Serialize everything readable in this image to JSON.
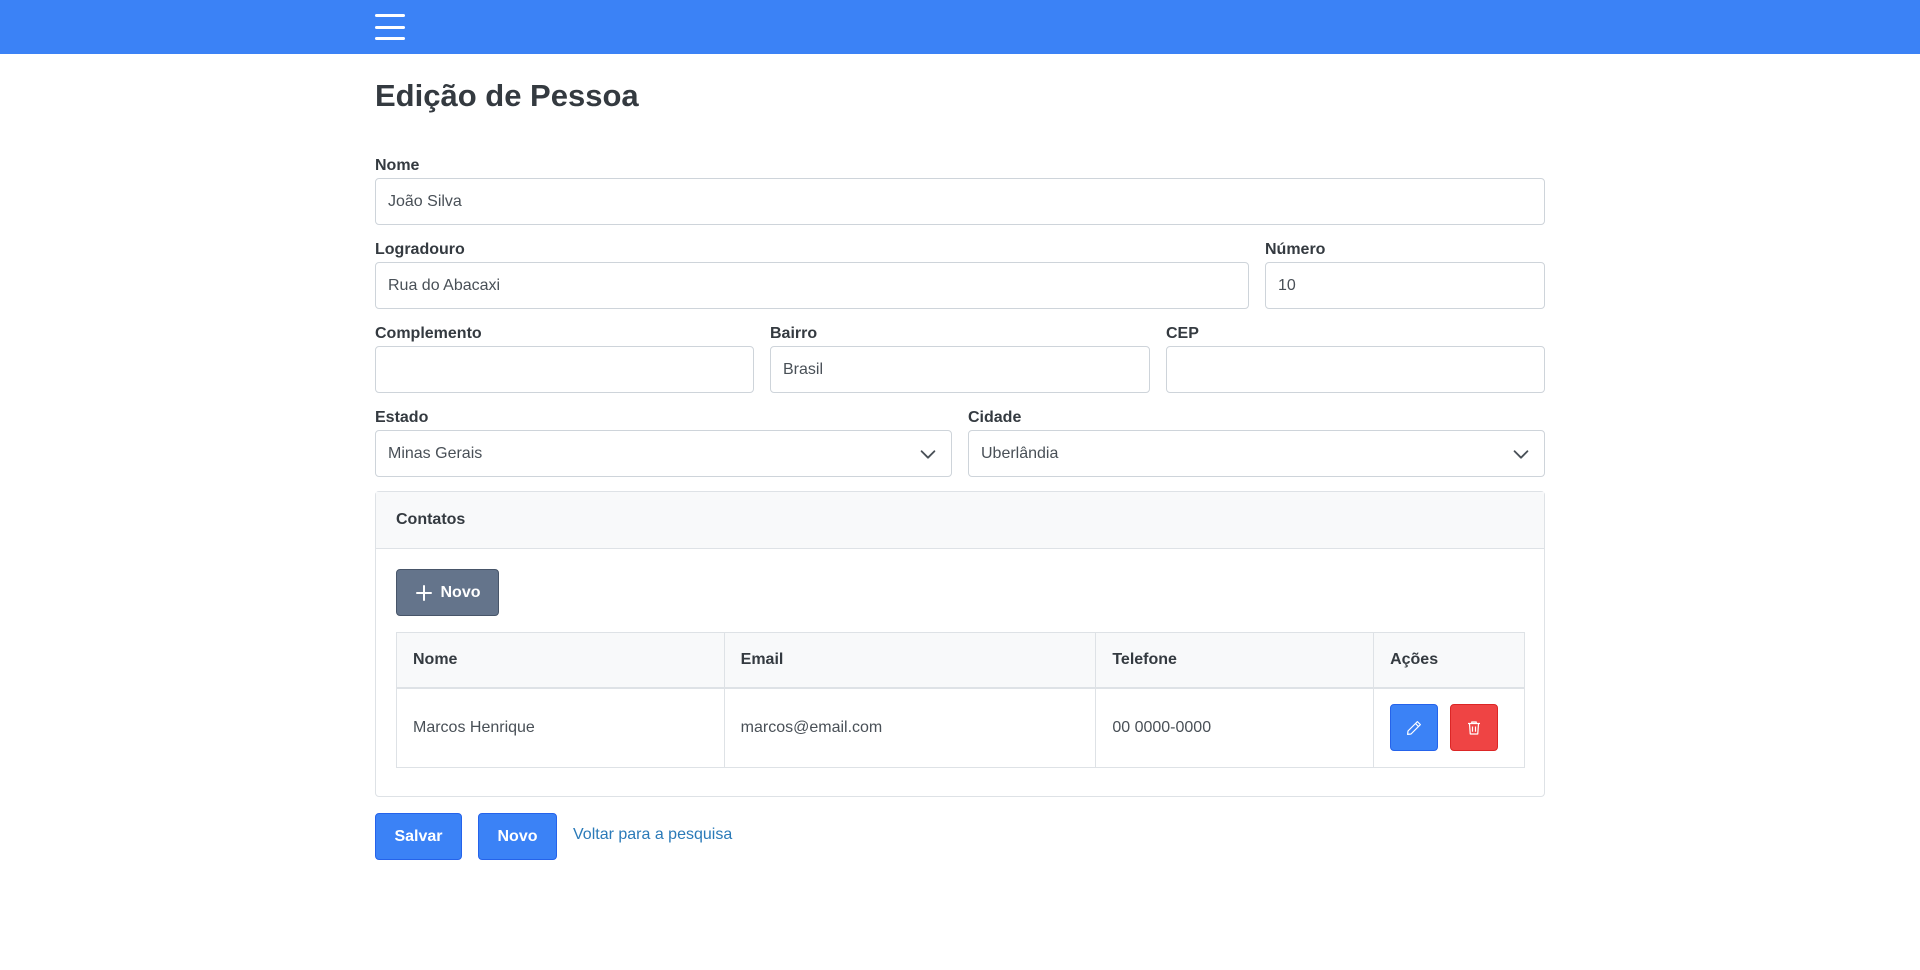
{
  "page": {
    "title": "Edição de Pessoa"
  },
  "icons": {
    "menu": "hamburger-icon",
    "chevron": "chevron-down-icon",
    "plus": "plus-icon",
    "edit": "pencil-icon",
    "delete": "trash-icon"
  },
  "colors": {
    "primary": "#3b82f6",
    "danger": "#ef4444",
    "secondary": "#64748b",
    "link": "#2a7ab8"
  },
  "form": {
    "nome": {
      "label": "Nome",
      "value": "João Silva"
    },
    "logradouro": {
      "label": "Logradouro",
      "value": "Rua do Abacaxi"
    },
    "numero": {
      "label": "Número",
      "value": "10"
    },
    "complemento": {
      "label": "Complemento",
      "value": ""
    },
    "bairro": {
      "label": "Bairro",
      "value": "Brasil"
    },
    "cep": {
      "label": "CEP",
      "value": ""
    },
    "estado": {
      "label": "Estado",
      "value": "Minas Gerais"
    },
    "cidade": {
      "label": "Cidade",
      "value": "Uberlândia"
    }
  },
  "contatos": {
    "title": "Contatos",
    "new_button": "Novo",
    "columns": [
      "Nome",
      "Email",
      "Telefone",
      "Ações"
    ],
    "rows": [
      {
        "nome": "Marcos Henrique",
        "email": "marcos@email.com",
        "telefone": "00 0000-0000"
      }
    ]
  },
  "actions": {
    "save": "Salvar",
    "new": "Novo",
    "back": "Voltar para a pesquisa"
  }
}
